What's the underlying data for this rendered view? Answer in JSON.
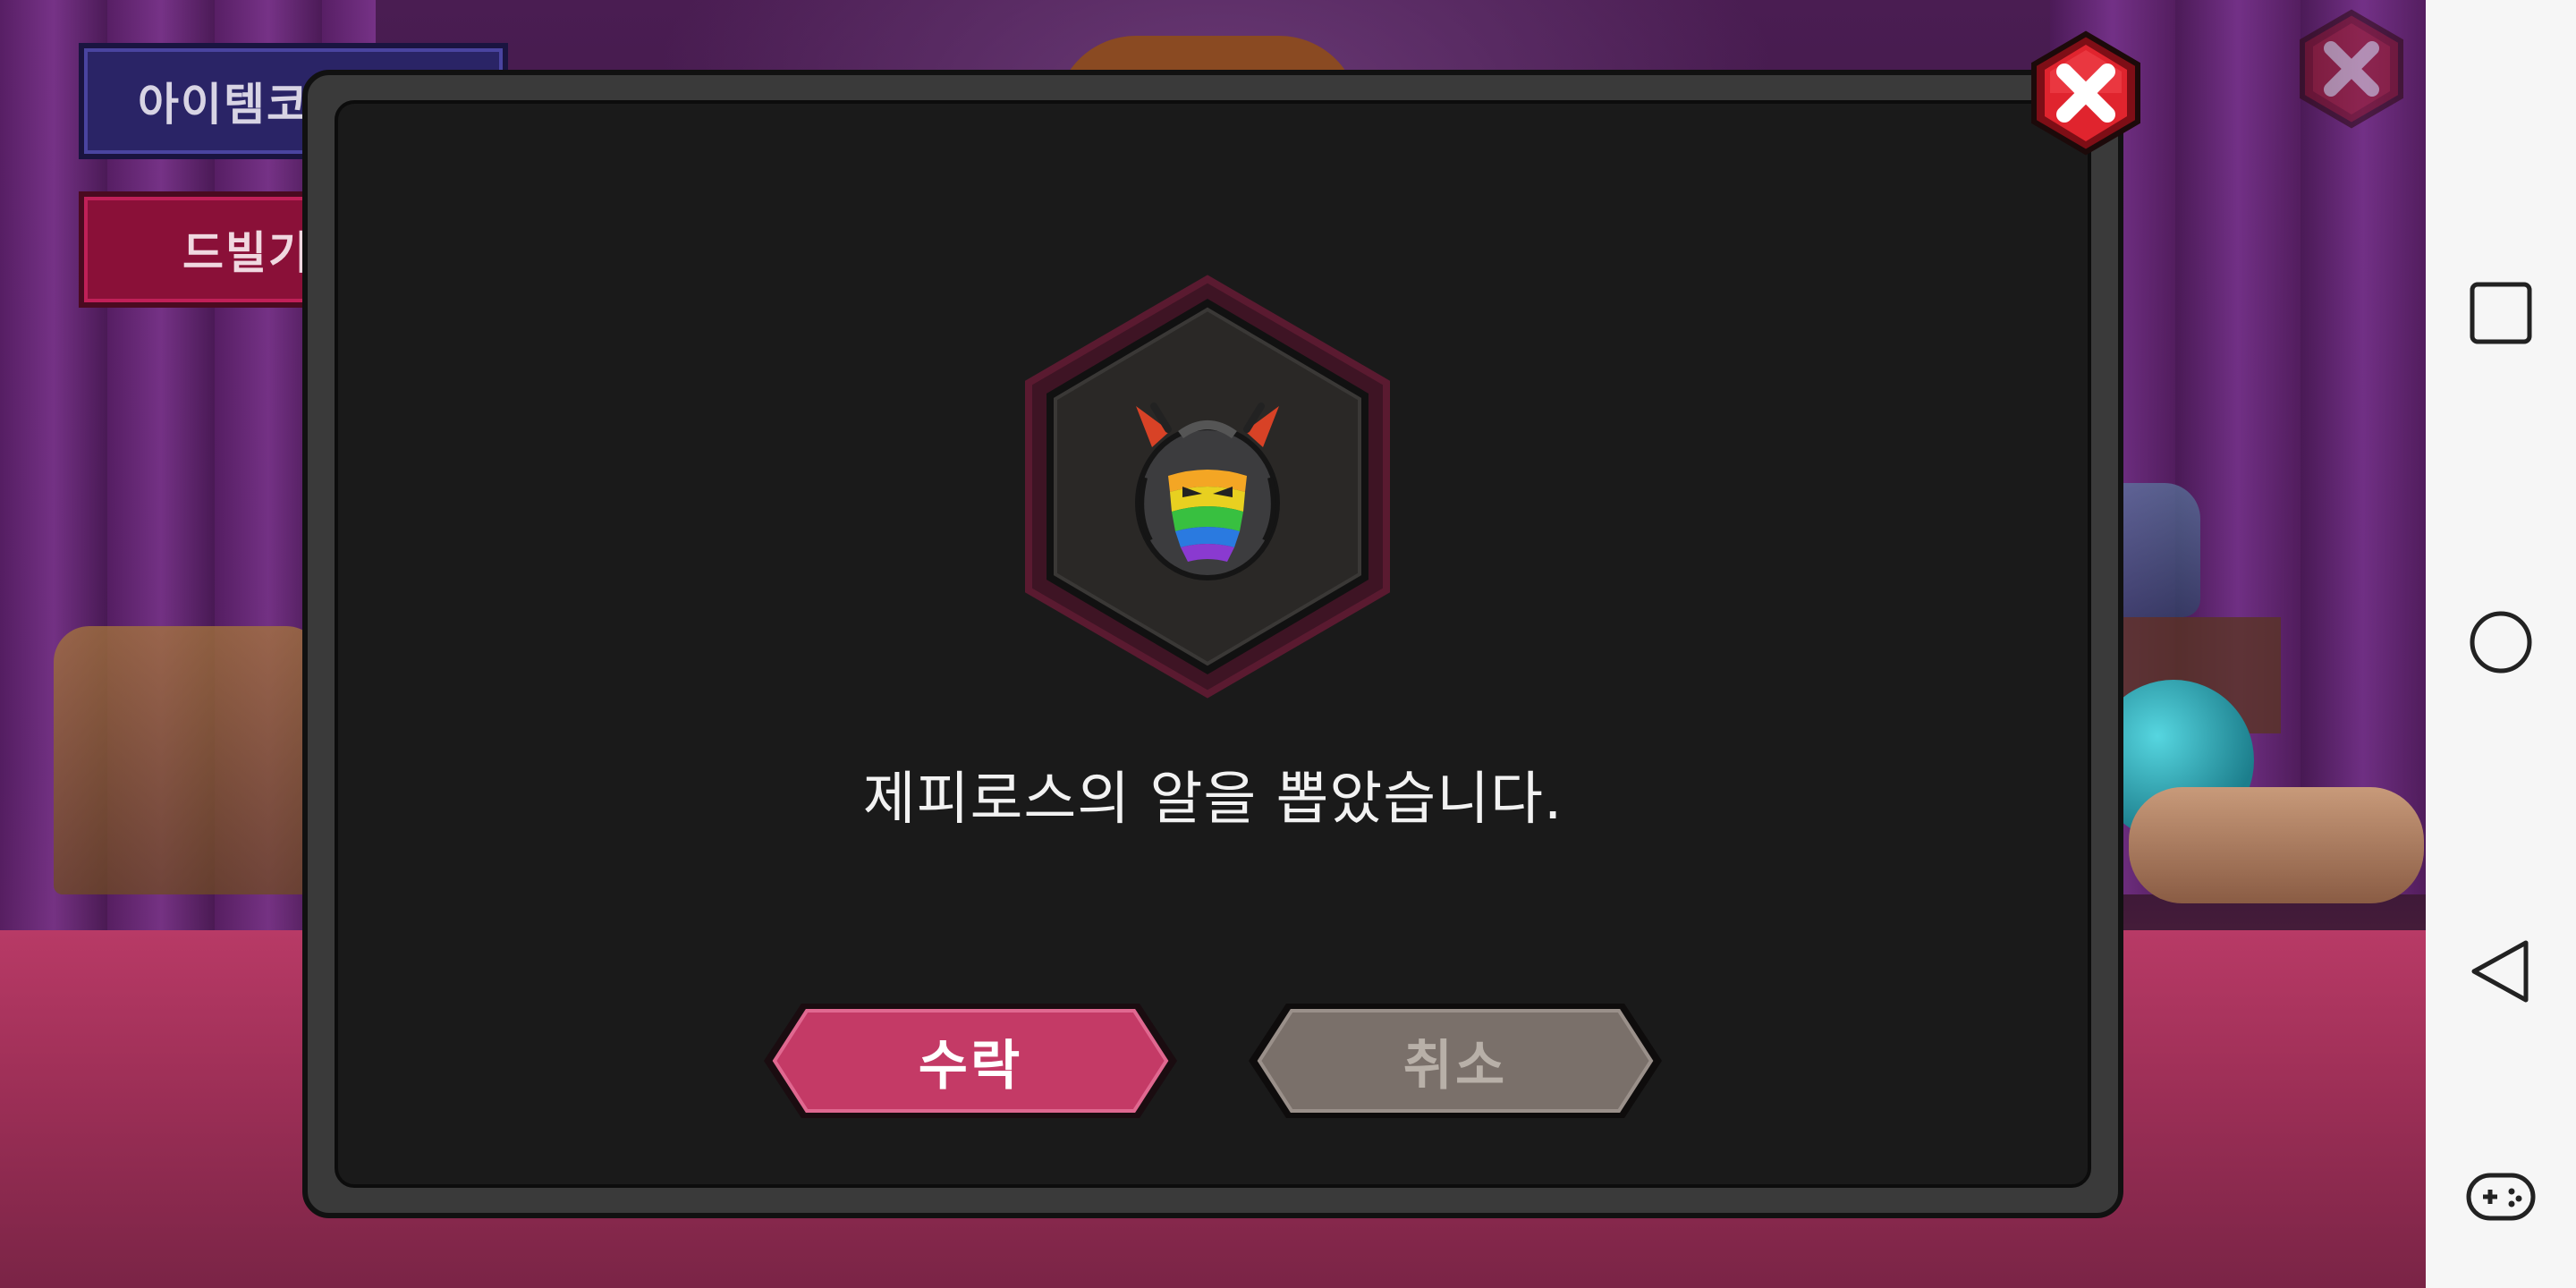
{
  "background": {
    "tab_item_label": "아이템코",
    "tab_drill_label": "드빌기"
  },
  "dialog": {
    "message": "제피로스의 알을 뽑았습니다.",
    "reward_icon": "zephyros-egg-icon",
    "accept_label": "수락",
    "cancel_label": "취소",
    "close_icon": "close-icon"
  },
  "navbar": {
    "icons": [
      "recent-apps-icon",
      "home-icon",
      "back-icon",
      "game-controller-icon"
    ]
  },
  "colors": {
    "accept_button": "#c43a66",
    "cancel_button": "#7a706a",
    "close_button": "#d8232e",
    "dialog_bg": "#1a1a1a"
  }
}
